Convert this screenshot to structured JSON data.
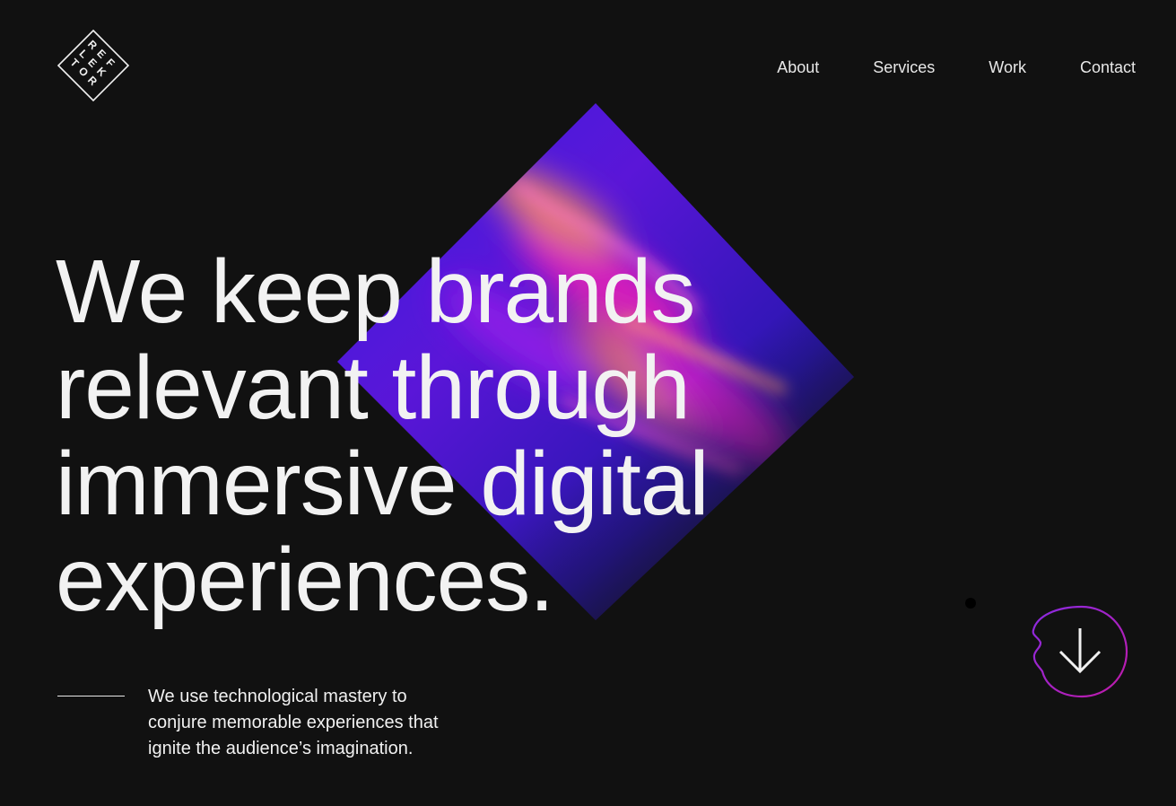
{
  "logo": {
    "letters": [
      "R",
      "E",
      "F",
      "L",
      "E",
      "K",
      "T",
      "O",
      "R"
    ],
    "icon": "reflektor-diamond-logo"
  },
  "nav": {
    "items": [
      {
        "label": "About"
      },
      {
        "label": "Services"
      },
      {
        "label": "Work"
      },
      {
        "label": "Contact"
      }
    ]
  },
  "hero": {
    "headline_lines": [
      "We keep brands",
      "relevant through",
      "immersive digital",
      "experiences."
    ],
    "intro": "We use technological mastery to conjure memorable experiences that ignite the audience’s imagination.",
    "art_icon": "gradient-diamond-art"
  },
  "scroll": {
    "icon": "arrow-down-icon"
  },
  "colors": {
    "background": "#111111",
    "text": "#f1f1f1",
    "accent_purple": "#8a2be2",
    "accent_magenta": "#c01aa8",
    "accent_salmon": "#e07a6e",
    "accent_blue": "#2b1bd6"
  }
}
